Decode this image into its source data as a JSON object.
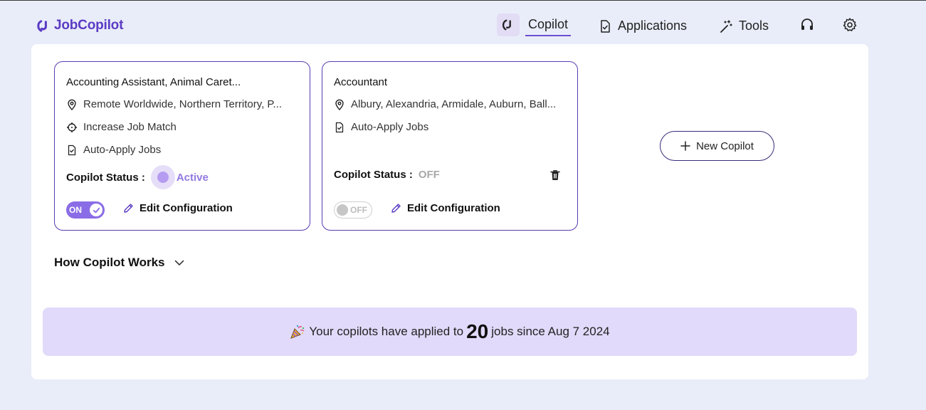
{
  "brand": {
    "name": "JobCopilot",
    "color": "#5b3bc4"
  },
  "nav": {
    "copilot": "Copilot",
    "applications": "Applications",
    "tools": "Tools"
  },
  "cards": [
    {
      "title": "Accounting Assistant, Animal Caret...",
      "location": "Remote Worldwide, Northern Territory, P...",
      "feature": "Increase Job Match",
      "mode": "Auto-Apply Jobs",
      "status_label": "Copilot Status :",
      "status_value": "Active",
      "toggle": "ON",
      "edit": "Edit Configuration"
    },
    {
      "title": "Accountant",
      "location": "Albury, Alexandria, Armidale, Auburn, Ball...",
      "mode": "Auto-Apply Jobs",
      "status_label": "Copilot Status :",
      "status_value": "OFF",
      "toggle": "OFF",
      "edit": "Edit Configuration"
    }
  ],
  "new_copilot": "New Copilot",
  "how_it_works": "How Copilot Works",
  "banner": {
    "prefix": "Your copilots have applied to",
    "count": "20",
    "suffix": "jobs since Aug 7 2024"
  },
  "colors": {
    "accent": "#8a6ce6",
    "background": "#e9edf9",
    "banner": "#e2dafa"
  }
}
